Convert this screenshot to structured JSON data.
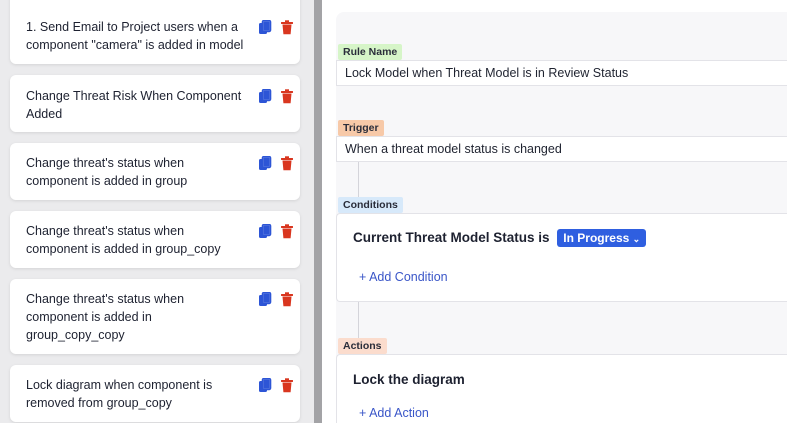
{
  "rules": [
    {
      "label": "1. Send Email to Project users when a component \"camera\" is added in model"
    },
    {
      "label": "Change Threat Risk When Component Added"
    },
    {
      "label": "Change threat's status when component is added in group"
    },
    {
      "label": "Change threat's status when component is added in group_copy"
    },
    {
      "label": "Change threat's status when component is added in group_copy_copy"
    },
    {
      "label": "Lock diagram when component is removed from group_copy"
    }
  ],
  "editor": {
    "rule_name_tag": "Rule Name",
    "rule_name_value": "Lock Model when Threat Model is in Review Status",
    "trigger_tag": "Trigger",
    "trigger_value": "When a threat model status is changed",
    "conditions_tag": "Conditions",
    "condition_text": "Current Threat Model Status is",
    "condition_status": "In Progress",
    "add_condition": "+ Add Condition",
    "actions_tag": "Actions",
    "action_text": "Lock the diagram",
    "add_action": "+ Add Action"
  },
  "colors": {
    "copy_icon": "#2d55d6",
    "delete_icon": "#d9361f",
    "status_pill": "#2f5fe0",
    "link": "#3a56c8"
  },
  "icons": {
    "copy": "copy-icon",
    "delete": "trash-icon",
    "dropdown": "chevron-down-icon"
  }
}
